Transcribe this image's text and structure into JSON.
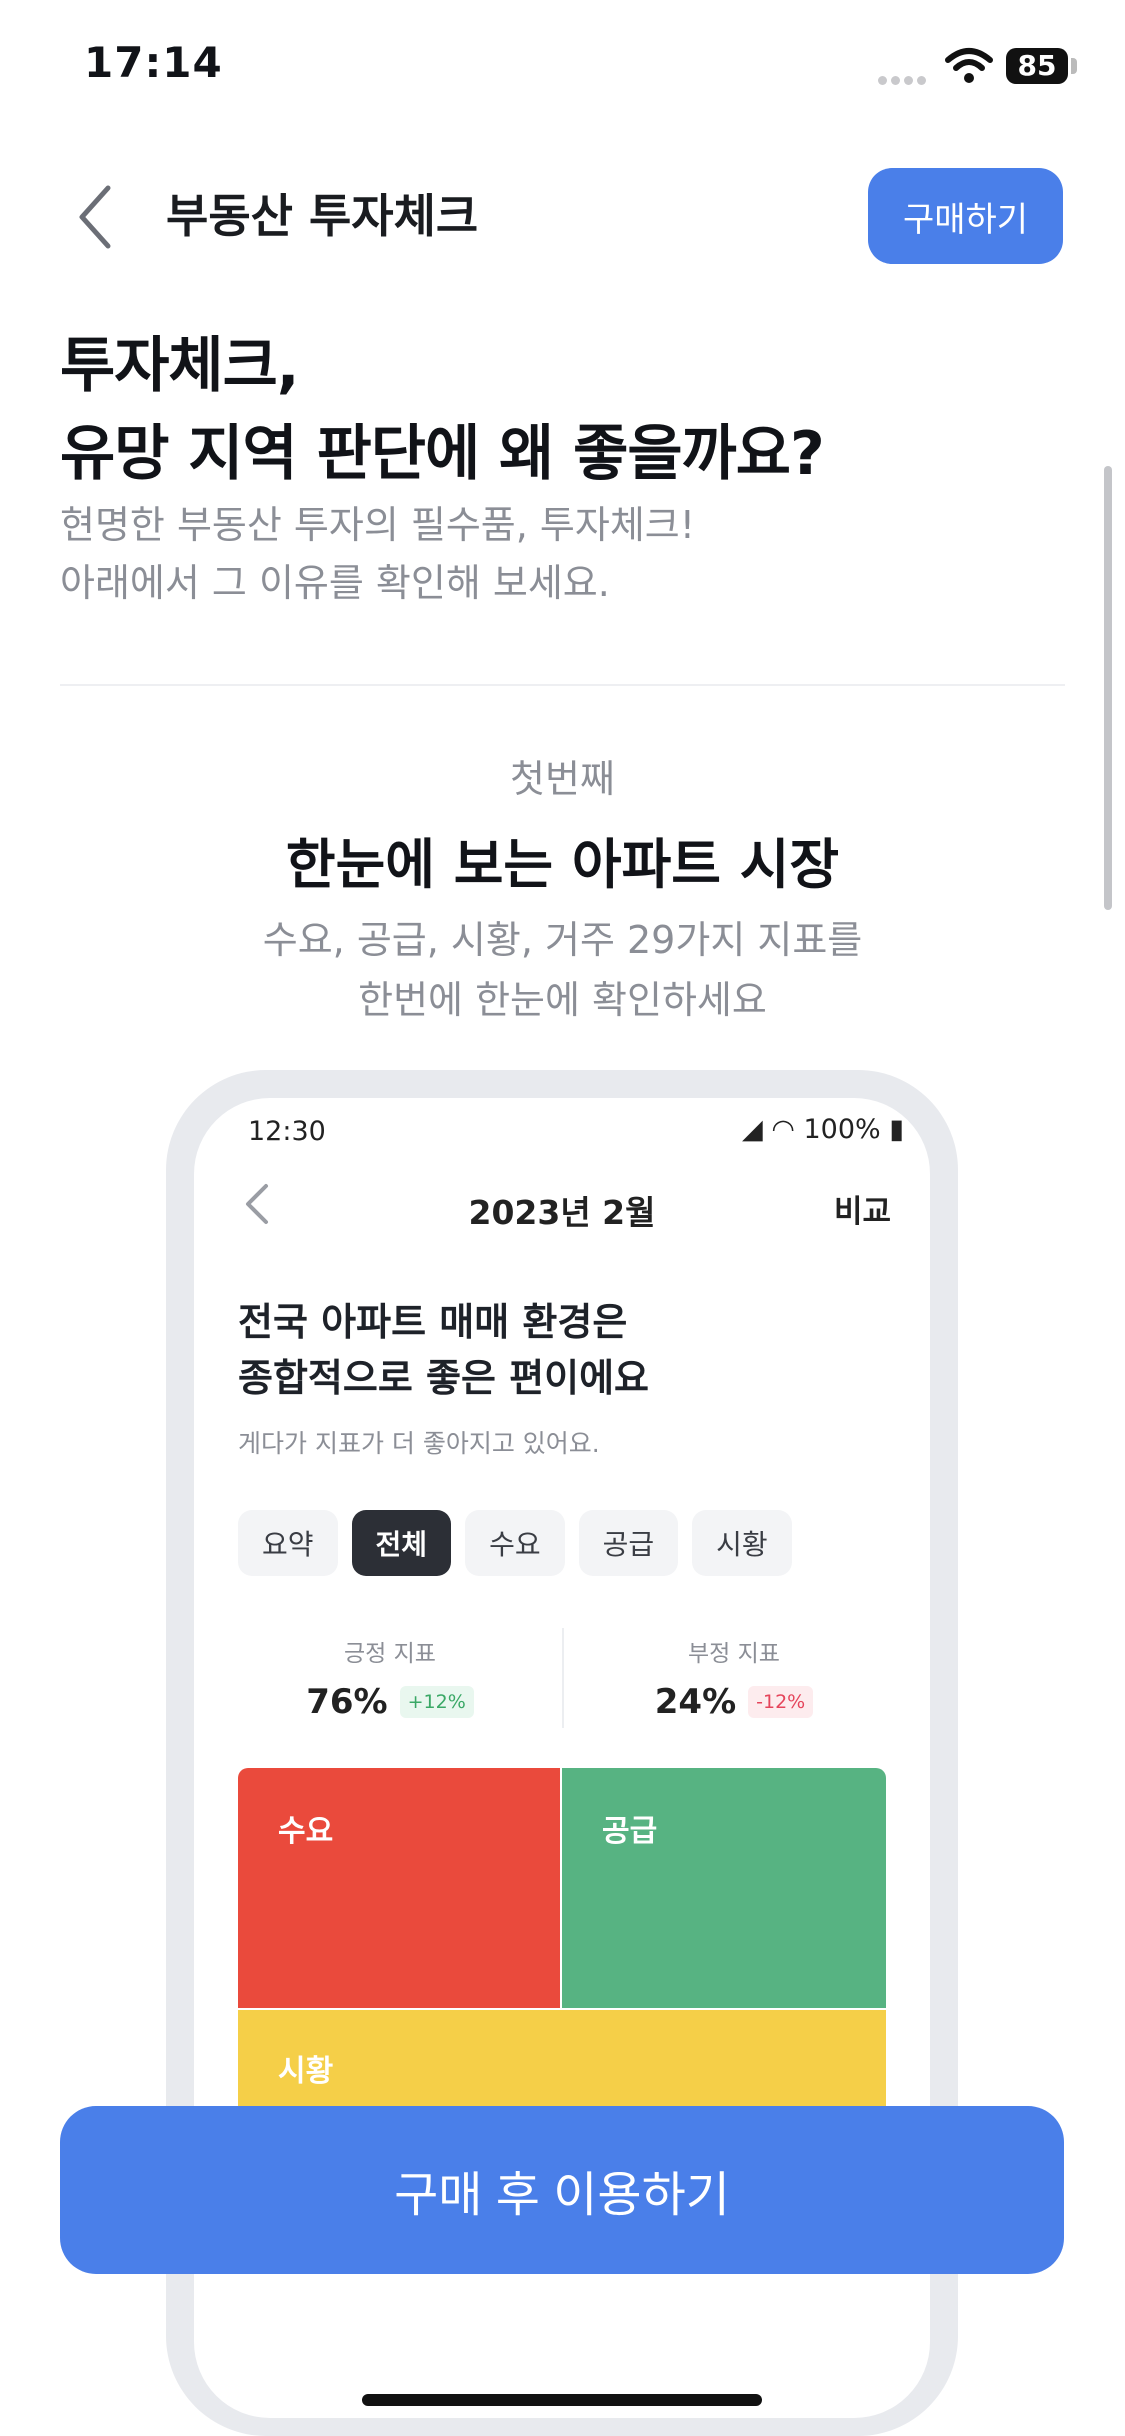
{
  "status_bar": {
    "time": "17:14",
    "battery": "85"
  },
  "header": {
    "title": "부동산 투자체크",
    "buy_label": "구매하기"
  },
  "hero": {
    "title_line1": "투자체크,",
    "title_line2": "유망 지역 판단에 왜 좋을까요?",
    "sub_line1": "현명한 부동산 투자의 필수품, 투자체크!",
    "sub_line2": "아래에서 그 이유를 확인해 보세요."
  },
  "section": {
    "kicker": "첫번째",
    "title": "한눈에 보는 아파트 시장",
    "desc_line1": "수요, 공급, 시황, 거주 29가지 지표를",
    "desc_line2": "한번에 한눈에 확인하세요"
  },
  "mockup": {
    "time": "12:30",
    "status": "◢ ◠ 100% ▮",
    "title": "2023년 2월",
    "compare": "비교",
    "headline_line1": "전국 아파트 매매 환경은",
    "headline_line2": "종합적으로 좋은 편이에요",
    "subtext": "게다가 지표가 더 좋아지고 있어요.",
    "chips": [
      "요약",
      "전체",
      "수요",
      "공급",
      "시황"
    ],
    "active_chip": "전체",
    "positive": {
      "label": "긍정 지표",
      "value": "76%",
      "delta": "+12%"
    },
    "negative": {
      "label": "부정 지표",
      "value": "24%",
      "delta": "-12%"
    },
    "treemap": {
      "demand": "수요",
      "supply": "공급",
      "market": "시황"
    },
    "colors": {
      "demand": "#ea4a3c",
      "supply": "#57b382",
      "market": "#f5cf48"
    }
  },
  "cta": {
    "label": "구매 후 이용하기"
  },
  "accent_color": "#4a7fe9"
}
